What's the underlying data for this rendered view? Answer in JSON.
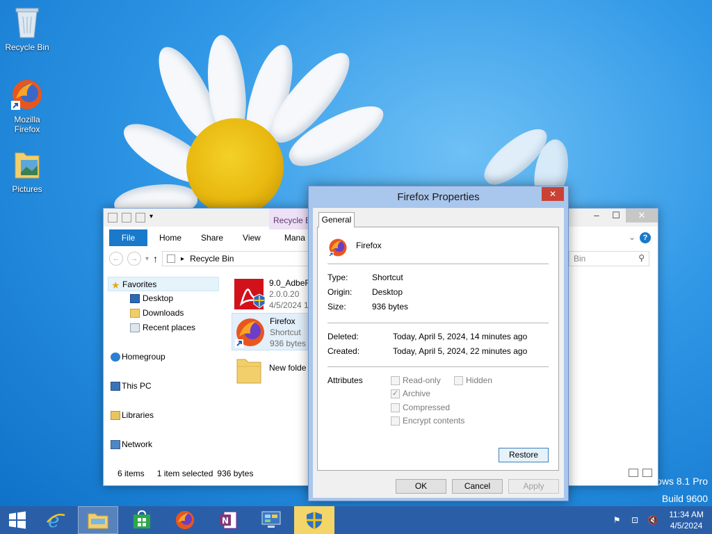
{
  "desktop": {
    "icons": [
      {
        "label": "Recycle Bin"
      },
      {
        "label": "Mozilla Firefox"
      },
      {
        "label": "Pictures"
      }
    ],
    "watermark": {
      "line1": "ows 8.1 Pro",
      "line2": "Build 9600"
    }
  },
  "explorer": {
    "contextual_tab": "Recycle Bin",
    "ribbon": {
      "file": "File",
      "home": "Home",
      "share": "Share",
      "view": "View",
      "manage": "Mana"
    },
    "address": "Recycle Bin",
    "search_placeholder": "Bin",
    "nav": {
      "favorites": "Favorites",
      "desktop": "Desktop",
      "downloads": "Downloads",
      "recent": "Recent places",
      "homegroup": "Homegroup",
      "thispc": "This PC",
      "libraries": "Libraries",
      "network": "Network"
    },
    "files": [
      {
        "name": "9.0_AdbeR",
        "line2": "2.0.0.20",
        "line3": "4/5/2024 1"
      },
      {
        "name": "Firefox",
        "line2": "Shortcut",
        "line3": "936 bytes"
      },
      {
        "name": "New folde",
        "line2": "",
        "line3": ""
      }
    ],
    "status": {
      "count": "6 items",
      "selected": "1 item selected",
      "size": "936 bytes"
    }
  },
  "properties": {
    "title": "Firefox Properties",
    "tab": "General",
    "name": "Firefox",
    "type_label": "Type:",
    "type_value": "Shortcut",
    "origin_label": "Origin:",
    "origin_value": "Desktop",
    "size_label": "Size:",
    "size_value": "936 bytes",
    "deleted_label": "Deleted:",
    "deleted_value": "Today, April 5, 2024, 14 minutes ago",
    "created_label": "Created:",
    "created_value": "Today, April 5, 2024, 22 minutes ago",
    "attributes_label": "Attributes",
    "attributes": {
      "readonly": "Read-only",
      "hidden": "Hidden",
      "archive": "Archive",
      "compressed": "Compressed",
      "encrypt": "Encrypt contents"
    },
    "restore_button": "Restore",
    "ok_button": "OK",
    "cancel_button": "Cancel",
    "apply_button": "Apply"
  },
  "taskbar": {
    "time": "11:34 AM",
    "date": "4/5/2024"
  }
}
